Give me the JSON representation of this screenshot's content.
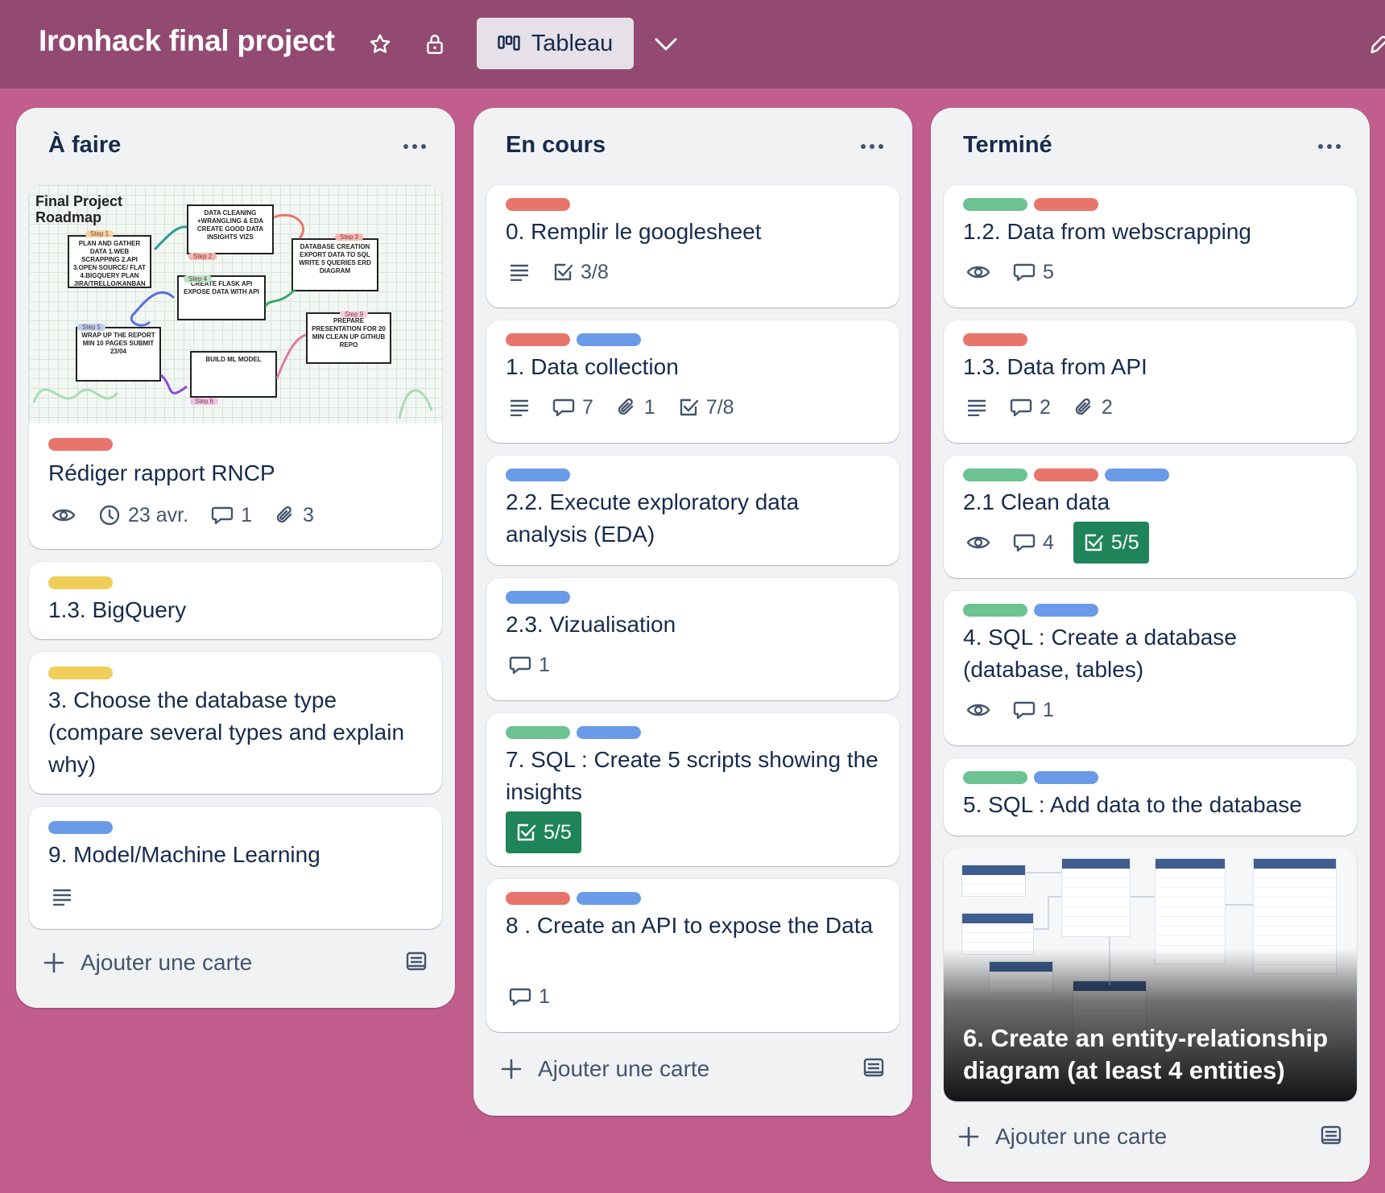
{
  "board": {
    "title": "Ironhack final project",
    "view_label": "Tableau",
    "background_color": "#c15e8e",
    "header_color": "#934a72"
  },
  "label_colors": {
    "green": "#6cc291",
    "red": "#e8756b",
    "blue": "#6a9be8",
    "yellow": "#efcf5a"
  },
  "lists": [
    {
      "title": "À faire",
      "add_card_label": "Ajouter une carte",
      "cards": [
        {
          "cover": "roadmap-image",
          "labels": [
            "red"
          ],
          "title": "Rédiger rapport RNCP",
          "badges": {
            "watching": true,
            "due": "23 avr.",
            "comments": "1",
            "attachments": "3"
          }
        },
        {
          "labels": [
            "yellow"
          ],
          "title": "1.3. BigQuery"
        },
        {
          "labels": [
            "yellow"
          ],
          "title": "3. Choose the database type (compare several types and explain why)"
        },
        {
          "labels": [
            "blue"
          ],
          "title": "9. Model/Machine Learning",
          "badges": {
            "description": true
          }
        }
      ]
    },
    {
      "title": "En cours",
      "add_card_label": "Ajouter une carte",
      "cards": [
        {
          "labels": [
            "red"
          ],
          "title": "0. Remplir le googlesheet",
          "badges": {
            "description": true,
            "checklist": "3/8"
          }
        },
        {
          "labels": [
            "red",
            "blue"
          ],
          "title": "1. Data collection",
          "badges": {
            "description": true,
            "comments": "7",
            "attachments": "1",
            "checklist": "7/8"
          }
        },
        {
          "labels": [
            "blue"
          ],
          "title": "2.2. Execute exploratory data analysis (EDA)"
        },
        {
          "labels": [
            "blue"
          ],
          "title": "2.3. Vizualisation",
          "badges": {
            "comments": "1"
          }
        },
        {
          "labels": [
            "green",
            "blue"
          ],
          "title": "7. SQL : Create 5 scripts showing the insights",
          "badges": {
            "checklist_complete": "5/5"
          }
        },
        {
          "labels": [
            "red",
            "blue"
          ],
          "title": "8 . Create an API to expose the Data",
          "badges": {
            "comments": "1"
          }
        }
      ]
    },
    {
      "title": "Terminé",
      "add_card_label": "Ajouter une carte",
      "cards": [
        {
          "labels": [
            "green",
            "red"
          ],
          "title": "1.2. Data from webscrapping",
          "badges": {
            "watching": true,
            "comments": "5"
          }
        },
        {
          "labels": [
            "red"
          ],
          "title": "1.3. Data from API",
          "badges": {
            "description": true,
            "comments": "2",
            "attachments": "2"
          }
        },
        {
          "labels": [
            "green",
            "red",
            "blue"
          ],
          "title": "2.1 Clean data",
          "badges": {
            "watching": true,
            "comments": "4",
            "checklist_complete": "5/5"
          }
        },
        {
          "labels": [
            "green",
            "blue"
          ],
          "title": "4. SQL : Create a database (database, tables)",
          "badges": {
            "watching": true,
            "comments": "1"
          }
        },
        {
          "labels": [
            "green",
            "blue"
          ],
          "title": "5. SQL : Add data to the database"
        },
        {
          "cover": "erd-image",
          "title": "6. Create an entity-relationship diagram (at least 4 entities)"
        }
      ]
    }
  ],
  "roadmap_image": {
    "title": "Final Project Roadmap",
    "boxes": [
      "PLAN AND GATHER DATA 1.WEB SCRAPPING 2.API 3.OPEN SOURCE/ FLAT 4.BIGQUERY PLAN JIRA/TRELLO/KANBAN",
      "DATA CLEANING +WRANGLING & EDA CREATE GOOD DATA INSIGHTS VIZS",
      "DATABASE CREATION EXPORT DATA TO SQL WRITE 5 QUERIES ERD DIAGRAM",
      "CREATE FLASK API EXPOSE DATA WITH API",
      "PREPARE PRESENTATION FOR 20 MIN CLEAN UP GITHUB REPO",
      "WRAP UP THE REPORT MIN 10 PAGES SUBMIT 23/04",
      "BUILD ML MODEL"
    ],
    "steps": [
      "Step 1",
      "Step 2",
      "Step 3",
      "Step 4",
      "Step 5",
      "Step 6",
      "Step 9"
    ]
  }
}
